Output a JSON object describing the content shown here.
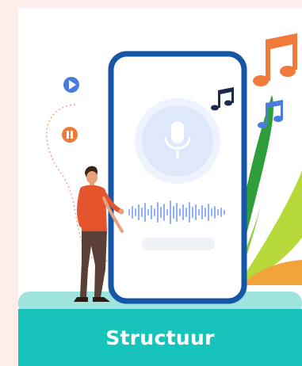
{
  "card": {
    "label": "Structuur"
  },
  "icons": [
    "play-icon",
    "pause-icon",
    "music-note-icon",
    "microphone-icon",
    "sound-wave-icon",
    "leaf-icon"
  ],
  "colors": {
    "background": "#fbeeeb",
    "card": "#ffffff",
    "footer": "#17c4bb",
    "phone_frame": "#1557a6",
    "accent_orange": "#f07a3a",
    "accent_blue": "#4a7be0",
    "leaf_green": "#2f9e3a"
  }
}
